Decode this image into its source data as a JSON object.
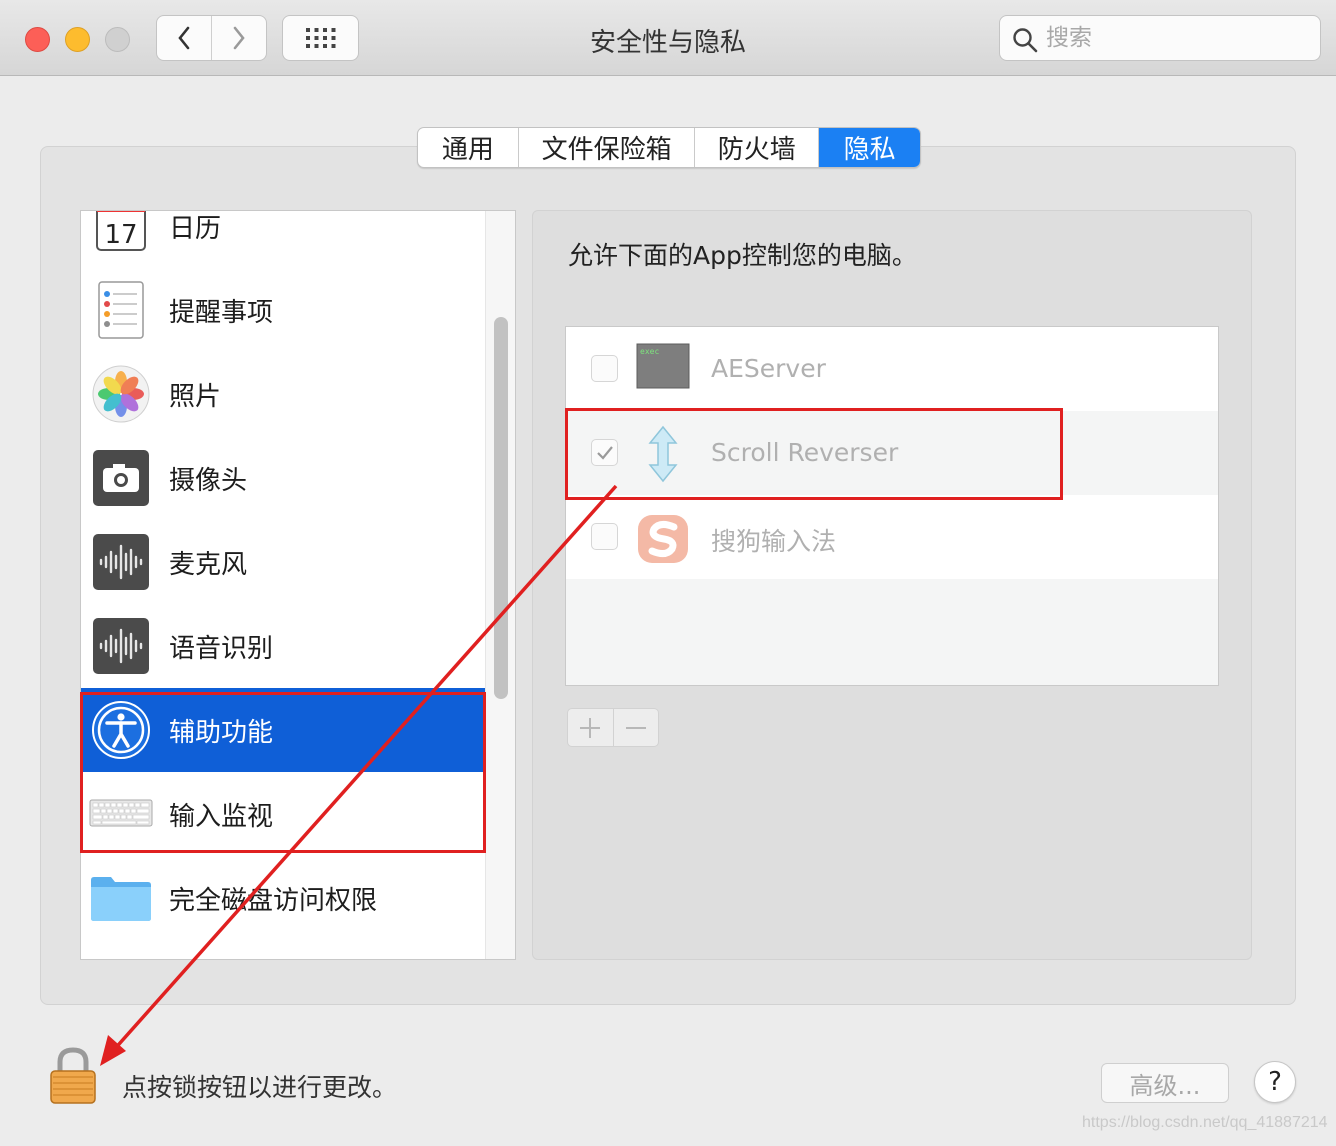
{
  "window": {
    "title": "安全性与隐私"
  },
  "search": {
    "placeholder": "搜索"
  },
  "tabs": [
    {
      "label": "通用"
    },
    {
      "label": "文件保险箱"
    },
    {
      "label": "防火墙"
    },
    {
      "label": "隐私",
      "active": true
    }
  ],
  "sidebar": {
    "items": [
      {
        "label": "日历",
        "icon": "calendar-icon",
        "icon_text": "17"
      },
      {
        "label": "提醒事项",
        "icon": "reminders-icon"
      },
      {
        "label": "照片",
        "icon": "photos-icon"
      },
      {
        "label": "摄像头",
        "icon": "camera-icon"
      },
      {
        "label": "麦克风",
        "icon": "microphone-icon"
      },
      {
        "label": "语音识别",
        "icon": "speech-recognition-icon"
      },
      {
        "label": "辅助功能",
        "icon": "accessibility-icon",
        "selected": true
      },
      {
        "label": "输入监视",
        "icon": "keyboard-icon"
      },
      {
        "label": "完全磁盘访问权限",
        "icon": "folder-icon"
      }
    ]
  },
  "panel": {
    "heading": "允许下面的App控制您的电脑。",
    "apps": [
      {
        "name": "AEServer",
        "checked": false,
        "icon": "exec-icon",
        "icon_text": "exec"
      },
      {
        "name": "Scroll Reverser",
        "checked": true,
        "icon": "scroll-reverser-icon"
      },
      {
        "name": "搜狗输入法",
        "checked": false,
        "icon": "sogou-icon"
      }
    ],
    "add_label": "+",
    "remove_label": "−"
  },
  "footer": {
    "lock_text": "点按锁按钮以进行更改。",
    "advanced_label": "高级...",
    "help_label": "?"
  },
  "watermark": "https://blog.csdn.net/qq_41887214",
  "colors": {
    "accent": "#1b80f3",
    "selection": "#0f5fd7",
    "annotation": "#e02020"
  }
}
